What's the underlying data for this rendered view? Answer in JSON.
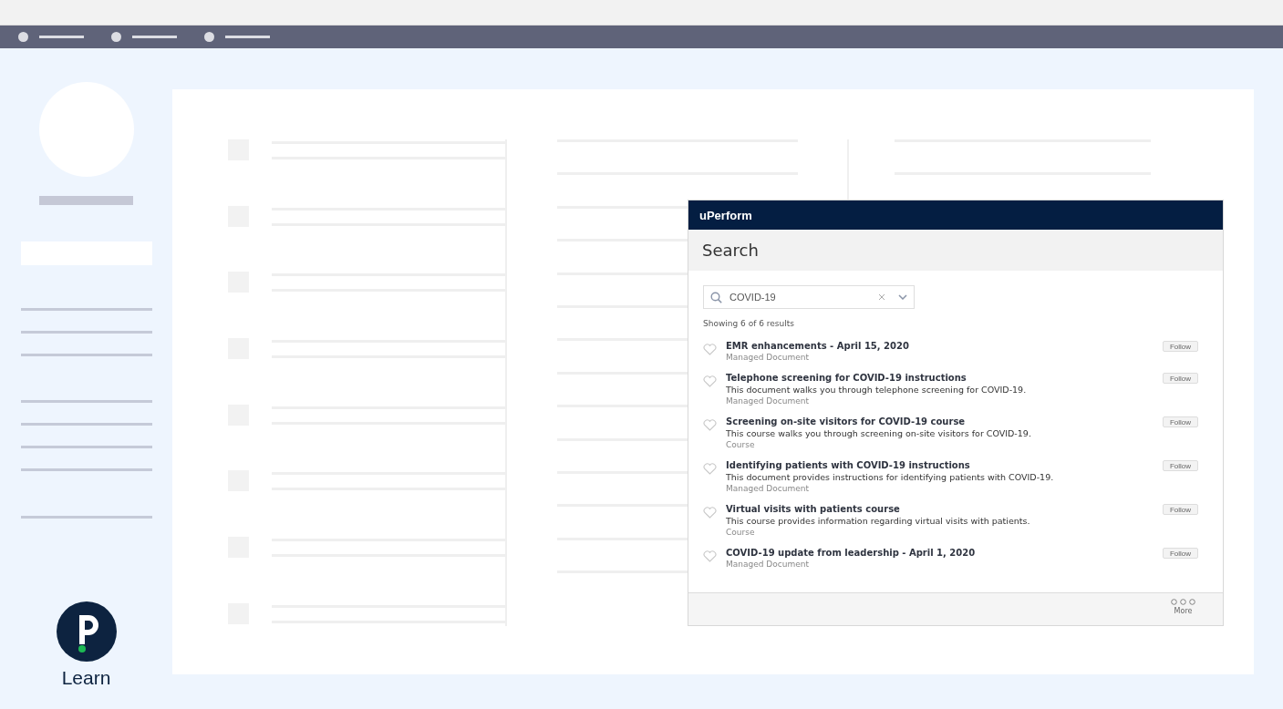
{
  "sidebar": {
    "app_label": "Learn"
  },
  "popup": {
    "brand": "uPerform",
    "title": "Search",
    "search": {
      "value": "COVID-19"
    },
    "results_summary": "Showing 6 of 6 results",
    "results": [
      {
        "title": "EMR enhancements - April 15, 2020",
        "type": "Managed Document",
        "button": "Follow"
      },
      {
        "title": "Telephone screening for COVID-19 instructions",
        "description": "This document walks you through telephone screening for COVID-19.",
        "type": "Managed Document",
        "button": "Follow"
      },
      {
        "title": "Screening on-site visitors for COVID-19 course",
        "description": "This course walks you through screening on-site visitors for COVID-19.",
        "type": "Course",
        "button": "Follow"
      },
      {
        "title": "Identifying patients with COVID-19 instructions",
        "description": "This document provides instructions for identifying patients with COVID-19.",
        "type": "Managed Document",
        "button": "Follow"
      },
      {
        "title": "Virtual visits with patients course",
        "description": "This course provides information regarding virtual visits with patients.",
        "type": "Course",
        "button": "Follow"
      },
      {
        "title": "COVID-19 update from leadership - April 1, 2020",
        "type": "Managed Document",
        "button": "Follow"
      }
    ],
    "footer": {
      "more_label": "More"
    }
  }
}
